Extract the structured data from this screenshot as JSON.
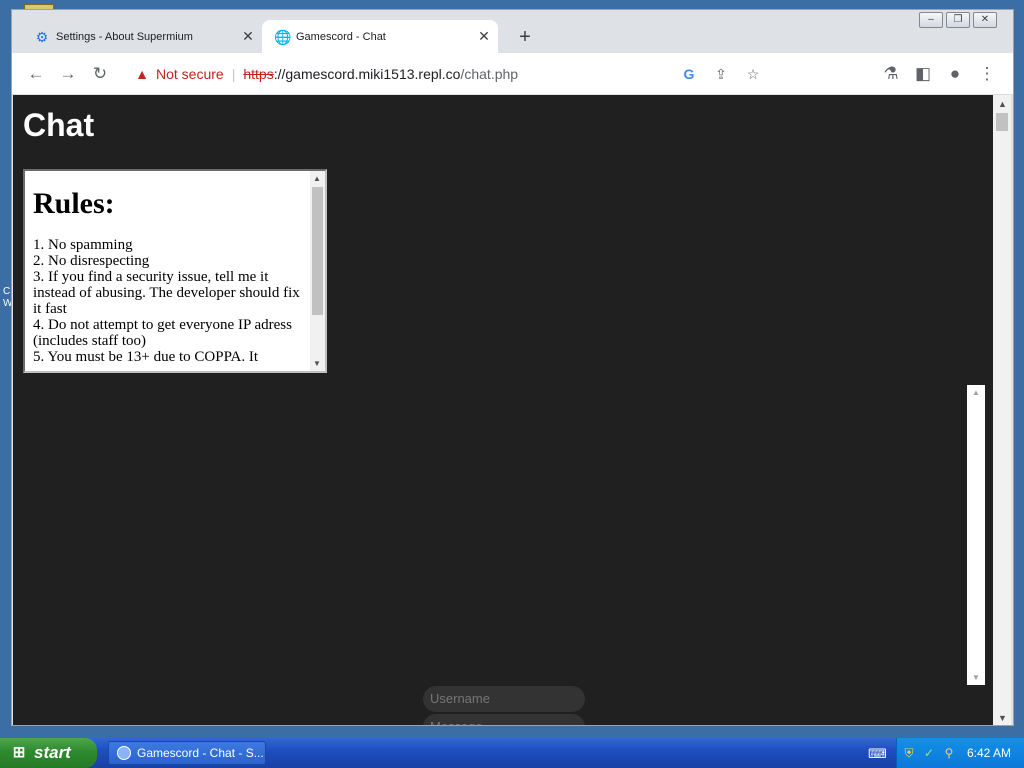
{
  "browser": {
    "tabs": [
      {
        "title": "Settings - About Supermium",
        "favicon": "gear-icon",
        "active": false
      },
      {
        "title": "Gamescord - Chat",
        "favicon": "globe-icon",
        "active": true
      }
    ],
    "security_label": "Not secure",
    "url": {
      "scheme": "https",
      "host": "://gamescord.miki1513.repl.co",
      "path": "/chat.php"
    }
  },
  "page": {
    "heading": "Chat",
    "rules": {
      "title": "Rules:",
      "items": [
        "1. No spamming",
        "2. No disrespecting",
        "3. If you find a security issue, tell me it instead of abusing. The developer should fix it fast",
        "4. Do not attempt to get everyone IP adress (includes staff too)",
        "5. You must be 13+ due to COPPA. It"
      ]
    },
    "inputs": {
      "username_placeholder": "Username",
      "message_placeholder": "Message"
    }
  },
  "taskbar": {
    "start_label": "start",
    "task_label": "Gamescord - Chat - S...",
    "clock": "6:42 AM"
  },
  "colors": {
    "page_bg": "#202020",
    "not_secure": "#c5221f",
    "taskbar": "#245edb"
  }
}
